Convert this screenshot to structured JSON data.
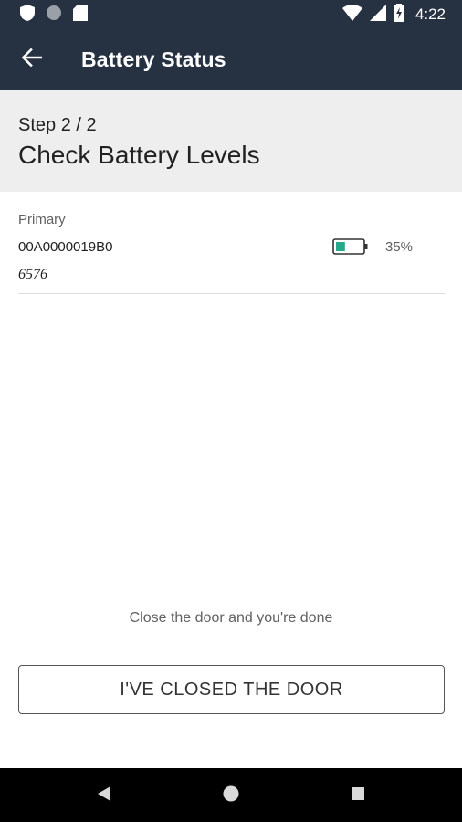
{
  "status_bar": {
    "time": "4:22",
    "left_icons": [
      "shield-icon",
      "circle-status-icon",
      "sd-card-icon"
    ],
    "right_icons": [
      "wifi-icon",
      "cell-signal-icon",
      "battery-charging-icon"
    ]
  },
  "app_bar": {
    "title": "Battery Status",
    "back_icon": "arrow-left-icon"
  },
  "step": {
    "label": "Step 2 / 2",
    "title": "Check Battery Levels"
  },
  "devices": [
    {
      "type": "Primary",
      "id": "00A0000019B0",
      "code": "6576",
      "battery_percent": "35%",
      "battery_level": 0.35,
      "battery_color": "#26a98b"
    }
  ],
  "footer": {
    "hint": "Close the door and you're done",
    "button_label": "I'VE CLOSED THE DOOR"
  },
  "nav_bar": {
    "buttons": [
      "back-triangle-icon",
      "home-circle-icon",
      "recents-square-icon"
    ]
  },
  "colors": {
    "app_bar": "#263142",
    "step_header_bg": "#eeeeee"
  }
}
